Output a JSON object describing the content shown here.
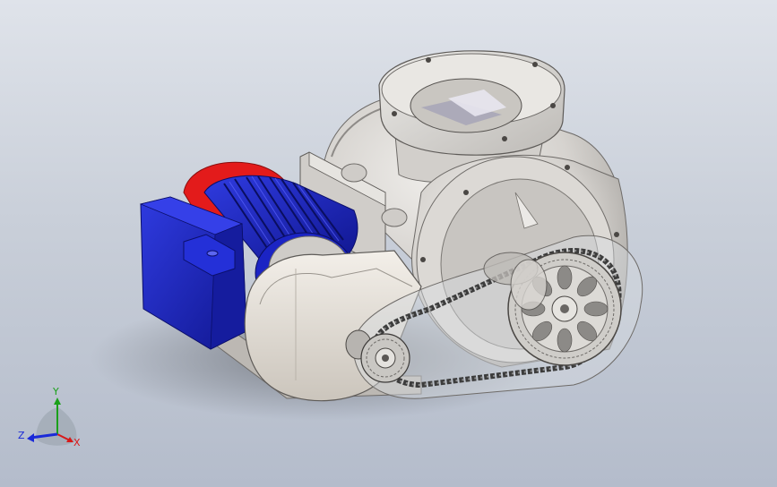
{
  "viewport": {
    "background_top": "#dfe3ea",
    "background_bottom": "#b4bccb"
  },
  "model": {
    "colors": {
      "housing": "#d9d6d2",
      "housing_shadow": "#a9a6a2",
      "motor_blue": "#1a22c8",
      "motor_red": "#e01818",
      "guard": "#e6e1da",
      "chain": "#5a5a5a"
    }
  },
  "triad": {
    "x_label": "X",
    "y_label": "Y",
    "z_label": "Z",
    "x_color": "#d81818",
    "y_color": "#1aa01a",
    "z_color": "#1a2ad8"
  }
}
